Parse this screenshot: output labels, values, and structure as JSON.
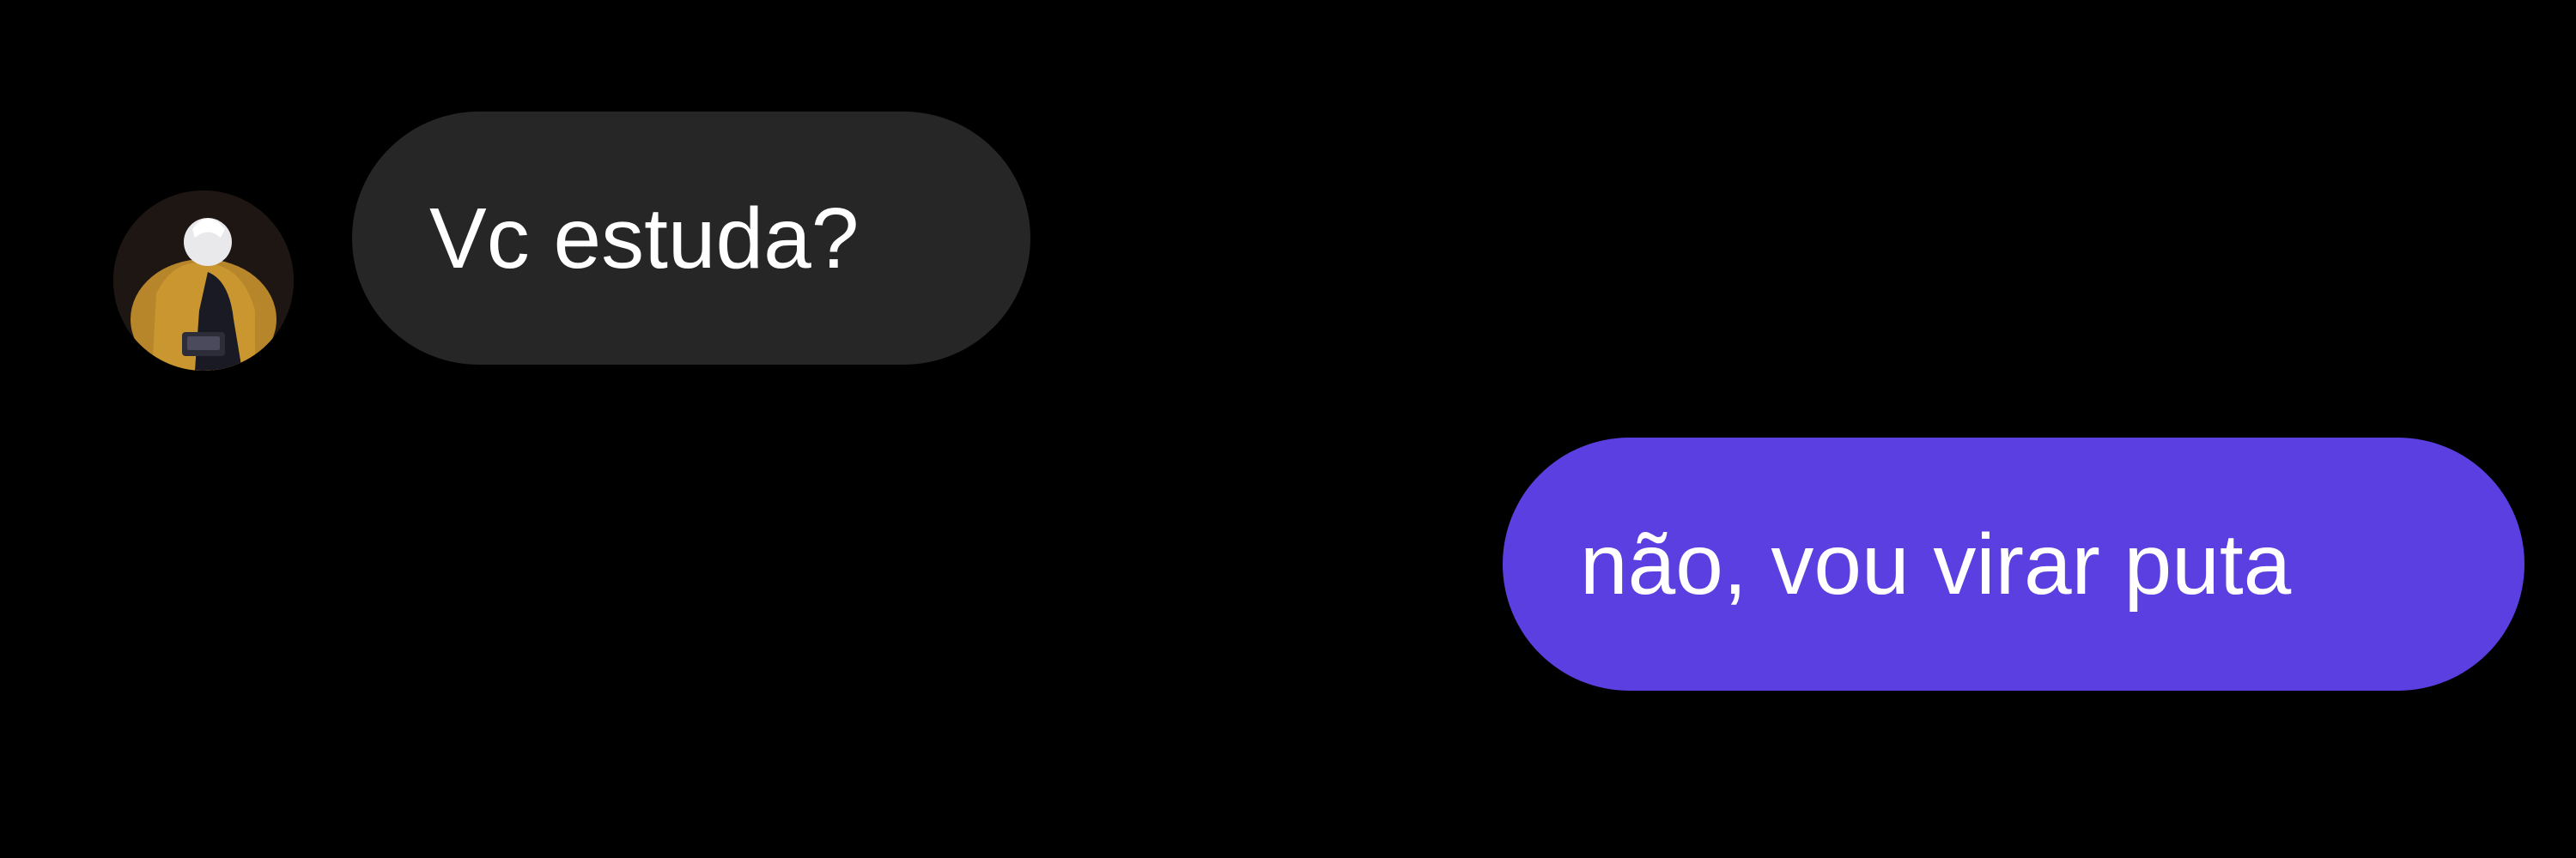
{
  "theme": {
    "background": "#000000",
    "incoming_bubble": "#262626",
    "outgoing_bubble": "#5b3fe0",
    "text": "#ffffff"
  },
  "conversation": {
    "messages": [
      {
        "direction": "incoming",
        "text": "Vc estuda?",
        "has_avatar": true,
        "avatar_icon": "contact-avatar-photo"
      },
      {
        "direction": "outgoing",
        "text": "não, vou virar puta"
      }
    ]
  }
}
